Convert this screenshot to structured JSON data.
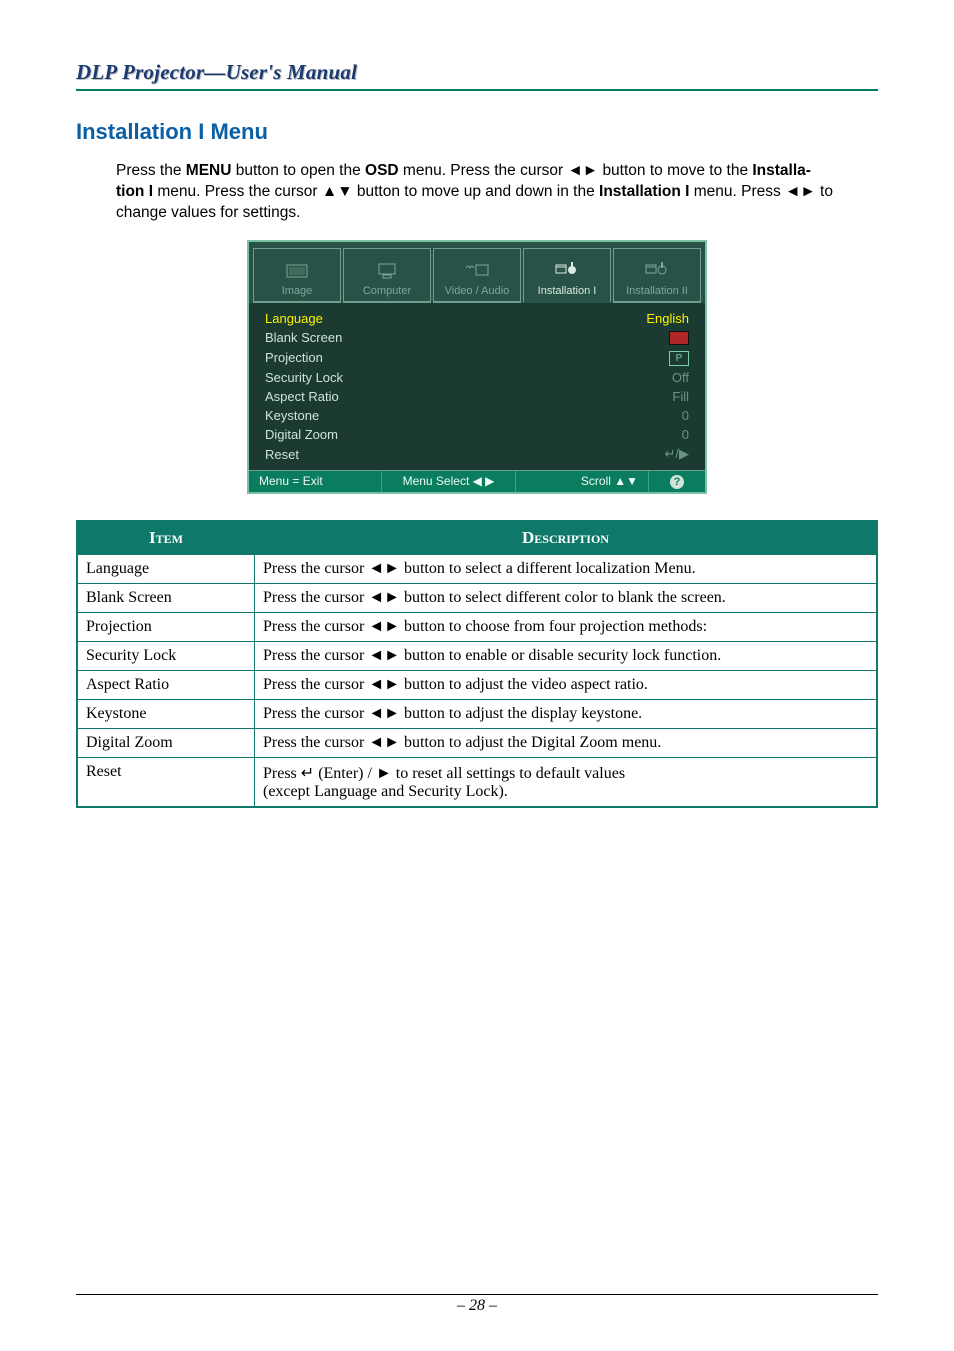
{
  "header": {
    "title": "DLP Projector—User's Manual"
  },
  "section": {
    "heading": "Installation I Menu"
  },
  "intro": {
    "text_before_menu": "Press the ",
    "menu_label": "MENU",
    "text_after_menu_before_osd": " button to open the ",
    "osd_label": "OSD",
    "text_after_osd": " menu. Press the cursor ◄► button to move to the ",
    "installa_label": "Installa-",
    "tion_label": "tion I",
    "after_tion": " menu. Press the cursor ▲▼ button to move up and down in the ",
    "inst_full_label": "Installation I",
    "after_inst_full": " menu. Press ◄► to change values for settings."
  },
  "osd": {
    "tabs": [
      {
        "label": "Image"
      },
      {
        "label": "Computer"
      },
      {
        "label": "Video / Audio"
      },
      {
        "label": "Installation I"
      },
      {
        "label": "Installation II"
      }
    ],
    "active_tab_index": 3,
    "items": [
      {
        "label": "Language",
        "value": "English",
        "value_type": "text-green",
        "highlight": true
      },
      {
        "label": "Blank Screen",
        "value": "",
        "value_type": "swatch",
        "highlight": false
      },
      {
        "label": "Projection",
        "value": "P",
        "value_type": "pbox",
        "highlight": false
      },
      {
        "label": "Security Lock",
        "value": "Off",
        "value_type": "text-dim",
        "highlight": false
      },
      {
        "label": "Aspect Ratio",
        "value": "Fill",
        "value_type": "text-dim",
        "highlight": false
      },
      {
        "label": "Keystone",
        "value": "0",
        "value_type": "text-dim",
        "highlight": false
      },
      {
        "label": "Digital Zoom",
        "value": "0",
        "value_type": "text-dim",
        "highlight": false
      },
      {
        "label": "Reset",
        "value": "↵/▶",
        "value_type": "text-dim",
        "highlight": false
      }
    ],
    "footer": {
      "exit": "Menu = Exit",
      "select": "Menu Select ◀ ▶",
      "scroll": "Scroll ▲▼",
      "help_icon": "?"
    }
  },
  "table": {
    "headers": {
      "item": "Item",
      "desc": "Description"
    },
    "rows": [
      {
        "item": "Language",
        "desc": "Press the cursor ◄► button to select a different localization Menu."
      },
      {
        "item": "Blank Screen",
        "desc": "Press the cursor ◄► button to select different color to blank the screen."
      },
      {
        "item": "Projection",
        "desc": "Press the cursor ◄► button to choose from four projection methods:"
      },
      {
        "item": "Security Lock",
        "desc": "Press the cursor ◄► button to enable or disable security lock function."
      },
      {
        "item": "Aspect Ratio",
        "desc": "Press the cursor ◄► button to adjust the video aspect ratio."
      },
      {
        "item": "Keystone",
        "desc": "Press the cursor ◄► button to adjust the display keystone."
      },
      {
        "item": "Digital Zoom",
        "desc": "Press the cursor ◄► button to adjust the Digital Zoom menu."
      },
      {
        "item": "Reset",
        "desc": "Press ↵ (Enter) / ► to reset all settings to default values\n(except Language and Security Lock)."
      }
    ]
  },
  "footer": {
    "page": "– 28 –"
  }
}
